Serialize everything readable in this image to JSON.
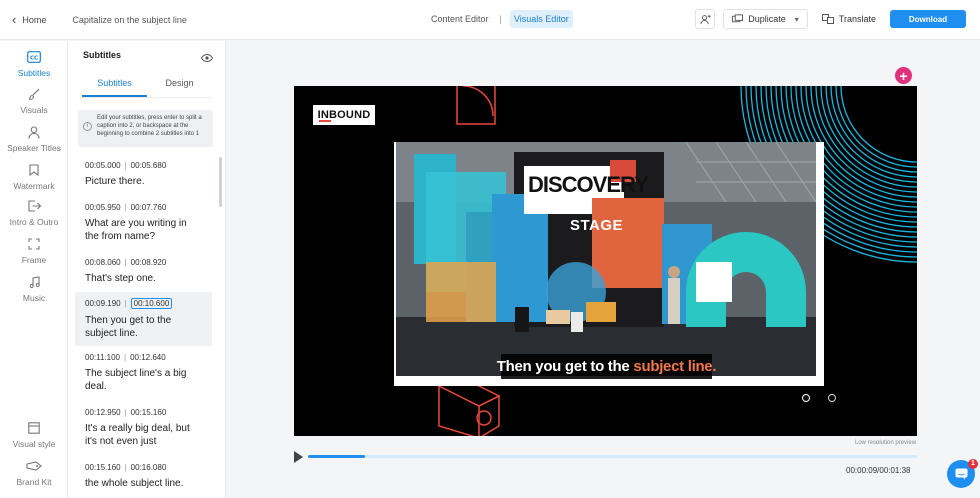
{
  "topbar": {
    "home_label": "Home",
    "project_title": "Capitalize on the subject line",
    "modes": [
      "Content Editor",
      "Visuals Editor"
    ],
    "mode_separator": "|",
    "duplicate_label": "Duplicate",
    "translate_label": "Translate",
    "download_label": "Download"
  },
  "rail": {
    "items": [
      {
        "label": "Subtitles",
        "icon": "cc-icon"
      },
      {
        "label": "Visuals",
        "icon": "brush-icon"
      },
      {
        "label": "Speaker Titles",
        "icon": "person-icon"
      },
      {
        "label": "Watermark",
        "icon": "bookmark-icon"
      },
      {
        "label": "Intro & Outro",
        "icon": "exit-icon"
      },
      {
        "label": "Frame",
        "icon": "frame-icon"
      },
      {
        "label": "Music",
        "icon": "music-note-icon"
      },
      {
        "label": "Visual style",
        "icon": "layout-icon"
      },
      {
        "label": "Brand Kit",
        "icon": "tag-icon"
      }
    ]
  },
  "panel": {
    "title": "Subtitles",
    "tabs": [
      "Subtitles",
      "Design"
    ],
    "hint": "Edit your subtitles, press enter to split a caption into 2, or backspace at the beginning to combine 2 subtitles into 1",
    "captions": [
      {
        "start": "00:05.000",
        "end": "00:05.680",
        "text": "Picture there."
      },
      {
        "start": "00:05.950",
        "end": "00:07.760",
        "text": "What are you writing in the from name?"
      },
      {
        "start": "00:08.060",
        "end": "00:08.920",
        "text": "That's step one."
      },
      {
        "start": "00:09.190",
        "end": "00:10.600",
        "text": "Then you get to the subject line."
      },
      {
        "start": "00:11.100",
        "end": "00:12.640",
        "text": "The subject line's a big deal."
      },
      {
        "start": "00:12.950",
        "end": "00:15.160",
        "text": "It's a really big deal, but it's not even just"
      },
      {
        "start": "00:15.160",
        "end": "00:16.080",
        "text": "the whole subject line."
      }
    ]
  },
  "stage": {
    "logo_text": "INBOUND",
    "sign_line1": "DISCOVERY",
    "sign_line2": "STAGE",
    "caption_main": "Then you get to the",
    "caption_highlight": "subject line.",
    "low_res_label": "Low resolution preview",
    "accent_color": "#f2784b"
  },
  "player": {
    "progress": 0.093,
    "timecode": "00:00:09/00:01:38"
  },
  "chat": {
    "badge": "1"
  }
}
